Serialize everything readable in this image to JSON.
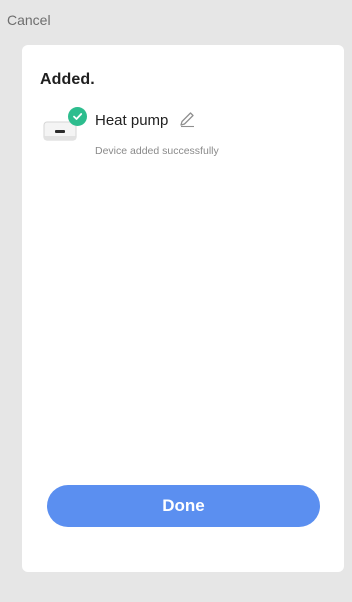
{
  "header": {
    "cancel_label": "Cancel"
  },
  "card": {
    "title": "Added.",
    "device": {
      "name": "Heat pump",
      "status": "Device added successfully",
      "image_icon": "heat-pump-device-image",
      "badge_icon": "check-circle-icon",
      "edit_icon": "pencil-icon"
    },
    "done_label": "Done"
  },
  "colors": {
    "accent": "#5b8ff0",
    "success": "#2dbd8e",
    "background": "#e6e6e6",
    "card": "#ffffff"
  }
}
